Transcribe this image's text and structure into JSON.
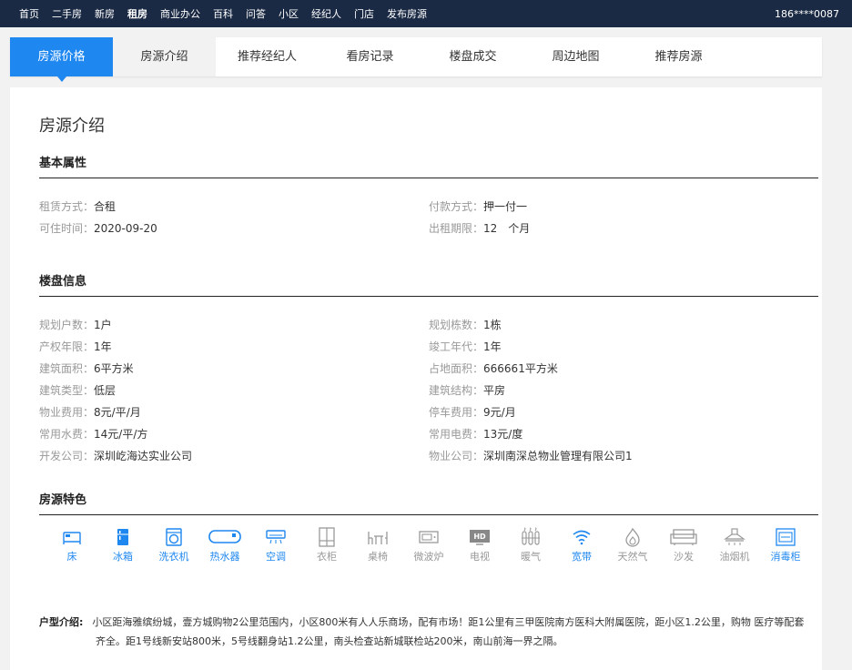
{
  "topbar": {
    "nav": [
      "首页",
      "二手房",
      "新房",
      "租房",
      "商业办公",
      "百科",
      "问答",
      "小区",
      "经纪人",
      "门店",
      "发布房源"
    ],
    "active_index": 3,
    "phone": "186****0087"
  },
  "tabs": [
    "房源价格",
    "房源介绍",
    "推荐经纪人",
    "看房记录",
    "楼盘成交",
    "周边地图",
    "推荐房源"
  ],
  "page_title": "房源介绍",
  "basic": {
    "title": "基本属性",
    "rows": [
      {
        "k": "租赁方式：",
        "v": "合租"
      },
      {
        "k": "付款方式：",
        "v": "押一付一"
      },
      {
        "k": "可住时间：",
        "v": "2020-09-20"
      },
      {
        "k": "出租期限：",
        "v": "12　个月"
      }
    ]
  },
  "estate": {
    "title": "楼盘信息",
    "rows": [
      {
        "k": "规划户数：",
        "v": "1户"
      },
      {
        "k": "规划栋数：",
        "v": "1栋"
      },
      {
        "k": "产权年限：",
        "v": "1年"
      },
      {
        "k": "竣工年代：",
        "v": "1年"
      },
      {
        "k": "建筑面积：",
        "v": "6平方米"
      },
      {
        "k": "占地面积：",
        "v": "666661平方米"
      },
      {
        "k": "建筑类型：",
        "v": "低层"
      },
      {
        "k": "建筑结构：",
        "v": "平房"
      },
      {
        "k": "物业费用：",
        "v": "8元/平/月"
      },
      {
        "k": "停车费用：",
        "v": "9元/月"
      },
      {
        "k": "常用水费：",
        "v": "14元/平/方"
      },
      {
        "k": "常用电费：",
        "v": "13元/度"
      },
      {
        "k": "开发公司：",
        "v": "深圳屹海达实业公司"
      },
      {
        "k": "物业公司：",
        "v": "深圳南深总物业管理有限公司1"
      }
    ]
  },
  "features": {
    "title": "房源特色",
    "items": [
      {
        "label": "床",
        "icon": "bed-icon",
        "on": true
      },
      {
        "label": "冰箱",
        "icon": "fridge-icon",
        "on": true
      },
      {
        "label": "洗衣机",
        "icon": "washer-icon",
        "on": true
      },
      {
        "label": "热水器",
        "icon": "water-heater-icon",
        "on": true
      },
      {
        "label": "空调",
        "icon": "air-conditioner-icon",
        "on": true
      },
      {
        "label": "衣柜",
        "icon": "wardrobe-icon",
        "on": false
      },
      {
        "label": "桌椅",
        "icon": "table-chair-icon",
        "on": false
      },
      {
        "label": "微波炉",
        "icon": "microwave-icon",
        "on": false
      },
      {
        "label": "电视",
        "icon": "tv-icon",
        "on": false
      },
      {
        "label": "暖气",
        "icon": "heater-icon",
        "on": false
      },
      {
        "label": "宽带",
        "icon": "wifi-icon",
        "on": true
      },
      {
        "label": "天然气",
        "icon": "gas-icon",
        "on": false
      },
      {
        "label": "沙发",
        "icon": "sofa-icon",
        "on": false
      },
      {
        "label": "油烟机",
        "icon": "range-hood-icon",
        "on": false
      },
      {
        "label": "消毒柜",
        "icon": "sterilizer-icon",
        "on": true
      }
    ]
  },
  "intro": {
    "label": "户型介绍:",
    "line1": "小区距海雅缤纷城，壹方城购物2公里范围内，小区800米有人人乐商场，配有市场！距1公里有三甲医院南方医科大附属医院，距小区1.2公里，购物 医疗等配套",
    "line2": "齐全。距1号线新安站800米，5号线翻身站1.2公里，南头检查站新城联检站200米，南山前海一界之隔。"
  },
  "colors": {
    "accent": "#1e87f0",
    "topbar": "#1b2a44",
    "muted": "#999999"
  }
}
